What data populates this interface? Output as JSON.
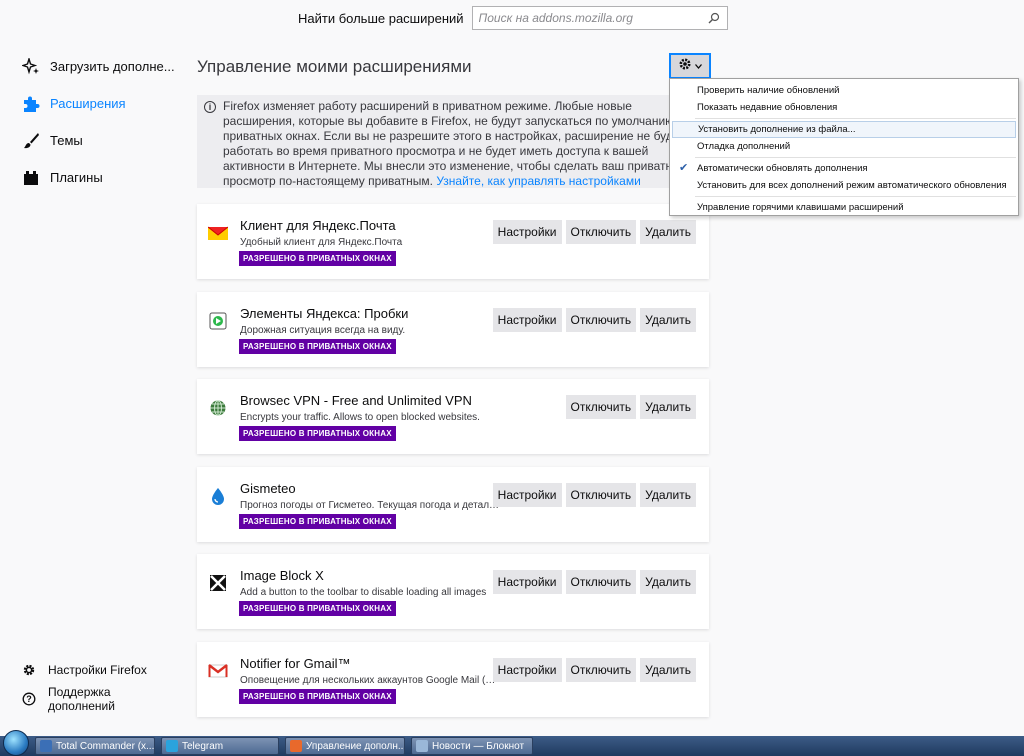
{
  "search": {
    "label": "Найти больше расширений",
    "placeholder": "Поиск на addons.mozilla.org"
  },
  "sidebar": {
    "items": [
      {
        "label": "Загрузить дополне...",
        "icon": "sparkle-icon"
      },
      {
        "label": "Расширения",
        "icon": "puzzle-icon",
        "active": true
      },
      {
        "label": "Темы",
        "icon": "brush-icon"
      },
      {
        "label": "Плагины",
        "icon": "plugin-icon"
      }
    ],
    "bottom": [
      {
        "label": "Настройки Firefox",
        "icon": "gear-icon"
      },
      {
        "label": "Поддержка дополнений",
        "icon": "help-icon"
      }
    ]
  },
  "main": {
    "title": "Управление моими расширениями",
    "notice_text": "Firefox изменяет работу расширений в приватном режиме. Любые новые расширения, которые вы добавите в Firefox, не будут запускаться по умолчанию в приватных окнах. Если вы не разрешите этого в настройках, расширение не будет работать во время приватного просмотра и не будет иметь доступа к вашей активности в Интернете. Мы внесли это изменение, чтобы сделать ваш приватный просмотр по-настоящему приватным. ",
    "notice_link": "Узнайте, как управлять настройками расширений.",
    "badge_label": "РАЗРЕШЕНО В ПРИВАТНЫХ ОКНАХ",
    "btn_settings": "Настройки",
    "btn_disable": "Отключить",
    "btn_remove": "Удалить"
  },
  "extensions": [
    {
      "name": "Клиент для Яндекс.Почта",
      "desc": "Удобный клиент для Яндекс.Почта",
      "icon": "yandex-mail-icon",
      "has_settings": true
    },
    {
      "name": "Элементы Яндекса: Пробки",
      "desc": "Дорожная ситуация всегда на виду.",
      "icon": "traffic-icon",
      "has_settings": true
    },
    {
      "name": "Browsec VPN - Free and Unlimited VPN",
      "desc": "Encrypts your traffic. Allows to open blocked websites.",
      "icon": "globe-icon",
      "has_settings": false
    },
    {
      "name": "Gismeteo",
      "desc": "Прогноз погоды от Гисметео. Текущая погода и детальны...",
      "icon": "drop-icon",
      "has_settings": true
    },
    {
      "name": "Image Block X",
      "desc": "Add a button to the toolbar to disable loading all images",
      "icon": "image-block-icon",
      "has_settings": true
    },
    {
      "name": "Notifier for Gmail™",
      "desc": "Оповещение для нескольких аккаунтов Google Mail (Gmail)",
      "icon": "gmail-icon",
      "has_settings": true
    }
  ],
  "menu": {
    "items": [
      {
        "label": "Проверить наличие обновлений"
      },
      {
        "label": "Показать недавние обновления"
      },
      {
        "sep": true
      },
      {
        "label": "Установить дополнение из файла...",
        "highlight": true
      },
      {
        "label": "Отладка дополнений"
      },
      {
        "sep": true
      },
      {
        "label": "Автоматически обновлять дополнения",
        "checked": true
      },
      {
        "label": "Установить для всех дополнений режим автоматического обновления"
      },
      {
        "sep": true
      },
      {
        "label": "Управление горячими клавишами расширений"
      }
    ]
  },
  "taskbar": {
    "items": [
      {
        "label": "Total Commander (x...",
        "color": "#3b6fb6"
      },
      {
        "label": "Telegram",
        "color": "#2aa3dd"
      },
      {
        "label": "Управление дополн...",
        "color": "#e8692c"
      },
      {
        "label": "Новости — Блокнот",
        "color": "#9ab7d8"
      }
    ]
  },
  "colors": {
    "accent": "#0a84ff",
    "badge": "#6200a4"
  }
}
